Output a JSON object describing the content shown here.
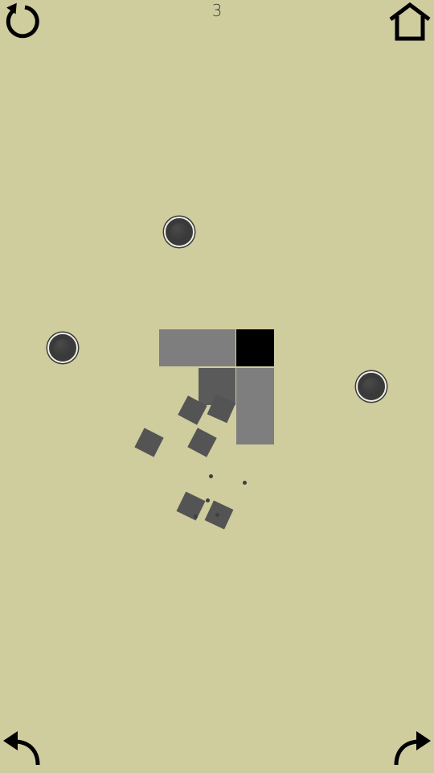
{
  "hud": {
    "level": "3",
    "restart_icon": "restart-icon",
    "home_icon": "home-icon",
    "undo_icon": "undo-icon",
    "redo_icon": "redo-icon"
  },
  "colors": {
    "background": "#cfcd9e",
    "ink": "#000000",
    "block_light": "#7e7e7e",
    "block_dark": "#5a5a5a",
    "block_target": "#000000",
    "ball": "#3a3a3a",
    "shard": "#545454"
  }
}
